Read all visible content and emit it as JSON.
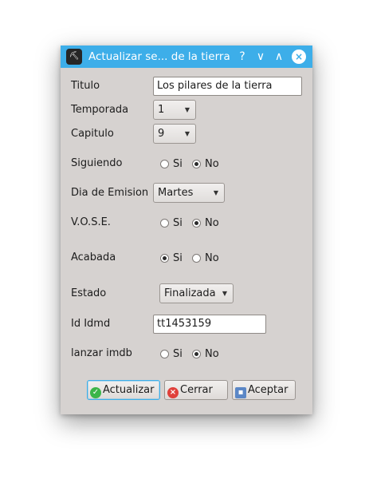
{
  "window": {
    "title": "Actualizar se... de la tierra",
    "app_icon_glyph": "⛏",
    "help_glyph": "?",
    "minimize_glyph": "∨",
    "maximize_glyph": "∧",
    "close_glyph": "×",
    "titlebar_color": "#3daee9"
  },
  "form": {
    "titulo": {
      "label": "Titulo",
      "value": "Los pilares de la tierra"
    },
    "temporada": {
      "label": "Temporada",
      "value": "1"
    },
    "capitulo": {
      "label": "Capitulo",
      "value": "9"
    },
    "siguiendo": {
      "label": "Siguiendo",
      "options": [
        "Si",
        "No"
      ],
      "selected": "No"
    },
    "dia_emision": {
      "label": "Dia de Emision",
      "value": "Martes"
    },
    "vose": {
      "label": "V.O.S.E.",
      "options": [
        "Si",
        "No"
      ],
      "selected": "No"
    },
    "acabada": {
      "label": "Acabada",
      "options": [
        "Si",
        "No"
      ],
      "selected": "Si"
    },
    "estado": {
      "label": "Estado",
      "value": "Finalizada"
    },
    "id_imdb": {
      "label": "Id Idmd",
      "value": "tt1453159"
    },
    "lanzar_imdb": {
      "label": "lanzar imdb",
      "options": [
        "Si",
        "No"
      ],
      "selected": "No"
    }
  },
  "buttons": {
    "actualizar": {
      "label": "Actualizar",
      "icon": "check-circle-icon",
      "color": "#3bb54a"
    },
    "cerrar": {
      "label": "Cerrar",
      "icon": "x-circle-icon",
      "color": "#e0403a"
    },
    "aceptar": {
      "label": "Aceptar",
      "icon": "save-icon",
      "color": "#5b87c6"
    }
  }
}
